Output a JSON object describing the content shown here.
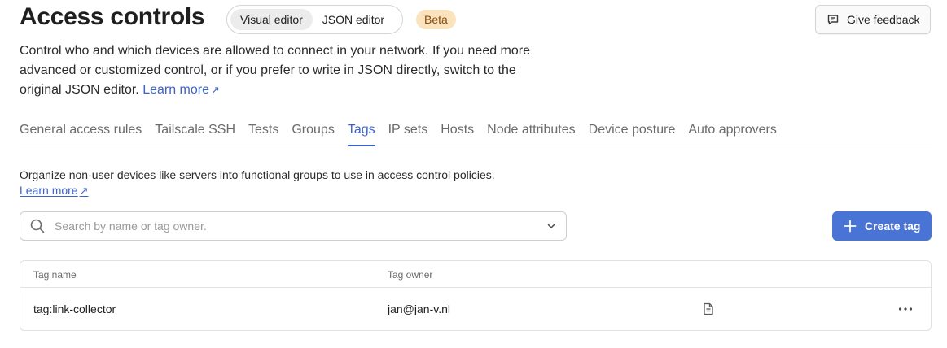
{
  "header": {
    "title": "Access controls",
    "editor_toggle": [
      {
        "label": "Visual editor",
        "active": true
      },
      {
        "label": "JSON editor",
        "active": false
      }
    ],
    "badge": "Beta",
    "feedback_label": "Give feedback"
  },
  "intro": {
    "text": "Control who and which devices are allowed to connect in your network. If you need more advanced or customized control, or if you prefer to write in JSON directly, switch to the original JSON editor.",
    "link": "Learn more",
    "link_icon": "arrow-up-right-icon"
  },
  "tabs": [
    {
      "label": "General access rules",
      "active": false
    },
    {
      "label": "Tailscale SSH",
      "active": false
    },
    {
      "label": "Tests",
      "active": false
    },
    {
      "label": "Groups",
      "active": false
    },
    {
      "label": "Tags",
      "active": true
    },
    {
      "label": "IP sets",
      "active": false
    },
    {
      "label": "Hosts",
      "active": false
    },
    {
      "label": "Node attributes",
      "active": false
    },
    {
      "label": "Device posture",
      "active": false
    },
    {
      "label": "Auto approvers",
      "active": false
    }
  ],
  "tags_section": {
    "description": "Organize non-user devices like servers into functional groups to use in access control policies.",
    "link": "Learn more",
    "search": {
      "placeholder": "Search by name or tag owner.",
      "value": ""
    },
    "create_label": "Create tag",
    "table": {
      "columns": [
        "Tag name",
        "Tag owner"
      ],
      "rows": [
        {
          "tag_name": "tag:link-collector",
          "tag_owner": "jan@jan-v.nl",
          "note_icon": "document-icon",
          "menu_icon": "more-horizontal-icon"
        }
      ]
    }
  },
  "colors": {
    "accent": "#4a73d6",
    "link": "#3d63c9",
    "beta_bg": "#fae3bd",
    "beta_text": "#8a4b0f"
  }
}
